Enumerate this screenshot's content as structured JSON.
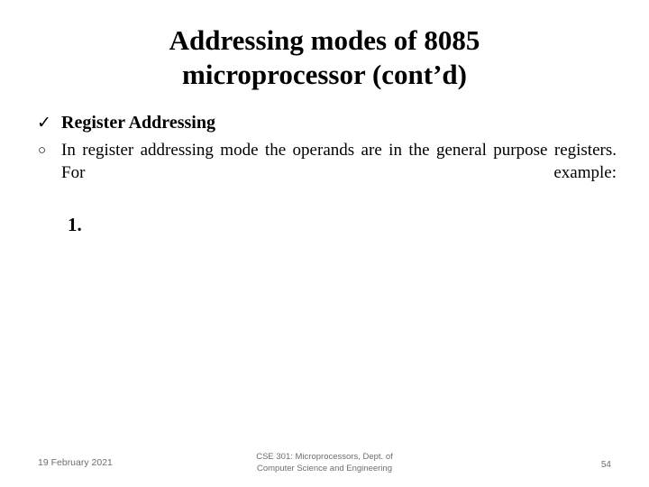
{
  "slide": {
    "title": {
      "line1": "Addressing modes of 8085",
      "line2": "microprocessor (cont’d)"
    },
    "bullets": [
      {
        "marker": "✓",
        "marker_name": "check-mark",
        "text": "Register Addressing"
      },
      {
        "marker": "○",
        "marker_name": "hollow-circle",
        "text": "In register addressing mode the operands are in the general purpose registers. For example:"
      }
    ],
    "numbered_item": "1."
  },
  "footer": {
    "date": "19 February 2021",
    "course_line1": "CSE 301: Microprocessors, Dept. of",
    "course_line2": "Computer Science and Engineering",
    "page_number": "54"
  },
  "colors": {
    "background": "#ffffff",
    "text": "#000000",
    "footer_text": "#6e6e6e"
  }
}
